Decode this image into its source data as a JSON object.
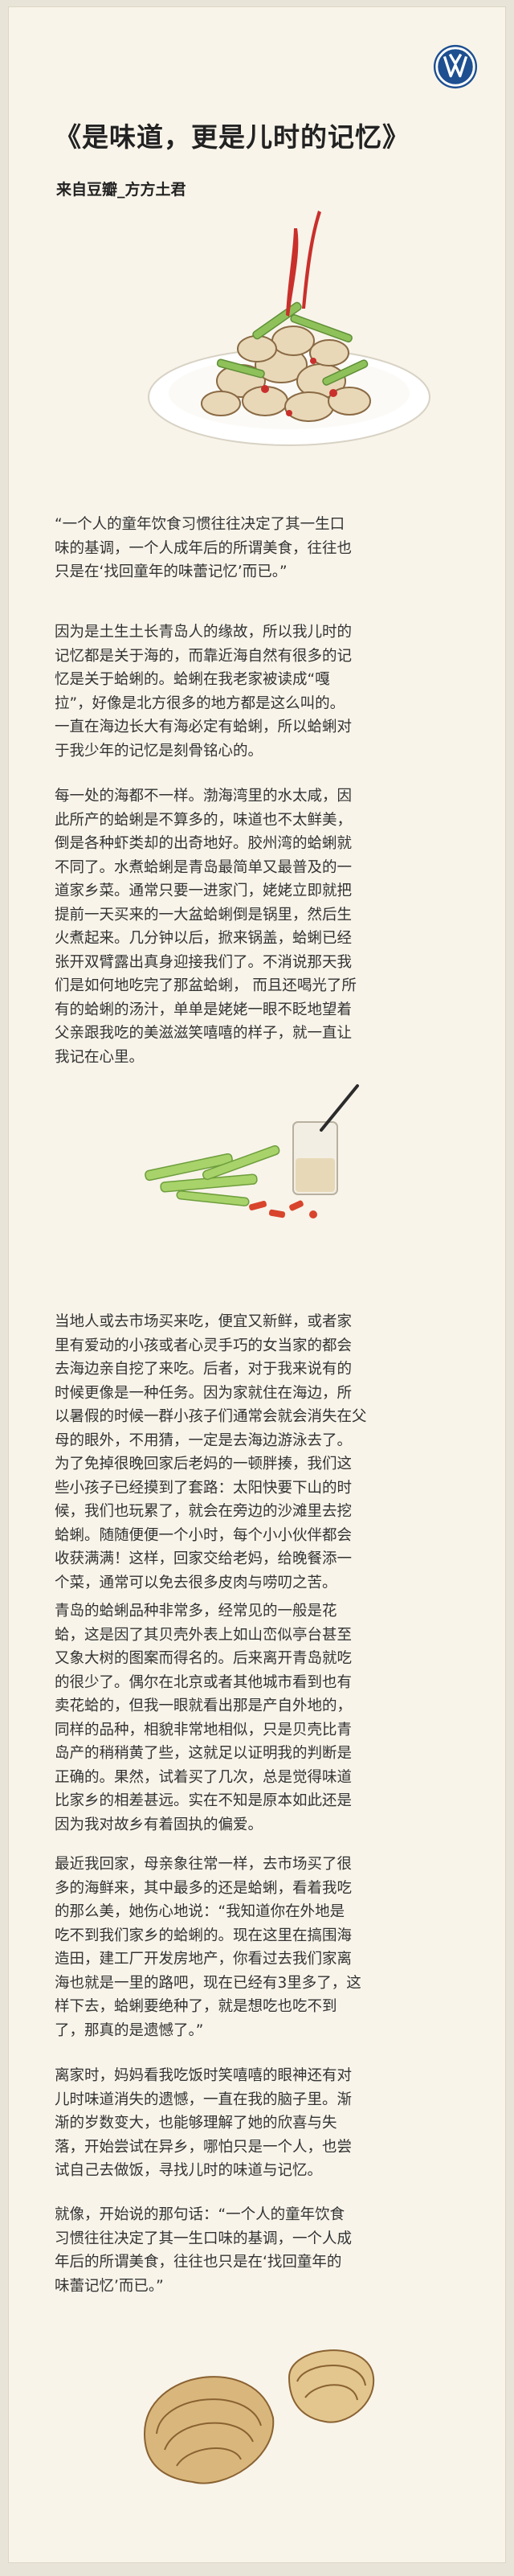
{
  "brand": {
    "logo_icon": "volkswagen-logo-icon",
    "color": "#1d4f91"
  },
  "article": {
    "title": "《是味道，更是儿时的记忆》",
    "author": "来自豆瓣_方方土君",
    "paragraphs": [
      "“一个人的童年饮食习惯往往决定了其一生口\n味的基调，一个人成年后的所谓美食，往往也\n只是在‘找回童年的味蕾记忆’而已。”",
      "因为是土生土长青岛人的缘故，所以我儿时的\n记忆都是关于海的，而靠近海自然有很多的记\n忆是关于蛤蜊的。蛤蜊在我老家被读成“嘎\n拉”，好像是北方很多的地方都是这么叫的。\n一直在海边长大有海必定有蛤蜊，所以蛤蜊对\n于我少年的记忆是刻骨铭心的。",
      "每一处的海都不一样。渤海湾里的水太咸，因\n此所产的蛤蜊是不算多的，味道也不太鲜美，\n倒是各种虾类却的出奇地好。胶州湾的蛤蜊就\n不同了。水煮蛤蜊是青岛最简单又最普及的一\n道家乡菜。通常只要一进家门，姥姥立即就把\n提前一天买来的一大盆蛤蜊倒是锅里，然后生\n火煮起来。几分钟以后，掀来锅盖，蛤蜊已经\n张开双臂露出真身迎接我们了。不消说那天我\n们是如何地吃完了那盆蛤蜊，  而且还喝光了所\n有的蛤蜊的汤汁，单单是姥姥一眼不眨地望着\n父亲跟我吃的美滋滋笑嘻嘻的样子，就一直让\n我记在心里。",
      "当地人或去市场买来吃，便宜又新鲜，或者家\n里有爱动的小孩或者心灵手巧的女当家的都会\n去海边亲自挖了来吃。后者，对于我来说有的\n时候更像是一种任务。因为家就住在海边，所\n以暑假的时候一群小孩子们通常会就会消失在父\n母的眼外，不用猜，一定是去海边游泳去了。\n为了免掉很晚回家后老妈的一顿胖揍，我们这\n些小孩子已经摸到了套路：太阳快要下山的时\n候，我们也玩累了，就会在旁边的沙滩里去挖\n蛤蜊。随随便便一个小时，每个小小伙伴都会\n收获满满！这样，回家交给老妈，给晚餐添一\n个菜，通常可以免去很多皮肉与唠叨之苦。",
      "青岛的蛤蜊品种非常多，经常见的一般是花\n蛤，这是因了其贝壳外表上如山峦似亭台甚至\n又象大树的图案而得名的。后来离开青岛就吃\n的很少了。偶尔在北京或者其他城市看到也有\n卖花蛤的，但我一眼就看出那是产自外地的，\n同样的品种，相貌非常地相似，只是贝壳比青\n岛产的稍稍黄了些，这就足以证明我的判断是\n正确的。果然，试着买了几次，总是觉得味道\n比家乡的相差甚远。实在不知是原本如此还是\n因为我对故乡有着固执的偏爱。",
      "最近我回家，母亲象往常一样，去市场买了很\n多的海鲜来，其中最多的还是蛤蜊，看着我吃\n的那么美，她伤心地说：“我知道你在外地是\n吃不到我们家乡的蛤蜊的。现在这里在搞围海\n造田，建工厂开发房地产，你看过去我们家离\n海也就是一里的路吧，现在已经有3里多了，这\n样下去，蛤蜊要绝种了，就是想吃也吃不到\n了，那真的是遗憾了。”",
      "离家时，妈妈看我吃饭时笑嘻嘻的眼神还有对\n儿时味道消失的遗憾，一直在我的脑子里。渐\n渐的岁数变大，也能够理解了她的欣喜与失\n落，开始尝试在异乡，哪怕只是一个人，也尝\n试自己去做饭，寻找儿时的味道与记忆。",
      "就像，开始说的那句话：“一个人的童年饮食\n习惯往往决定了其一生口味的基调，一个人成\n年后的所谓美食，往往也只是在‘找回童年的\n味蕾记忆’而已。”"
    ]
  },
  "illustrations": {
    "top_dish_icon": "clam-dish-with-chili-icon",
    "middle_icon": "vegetables-and-sauce-cup-icon",
    "bottom_icon": "clam-shells-icon"
  }
}
